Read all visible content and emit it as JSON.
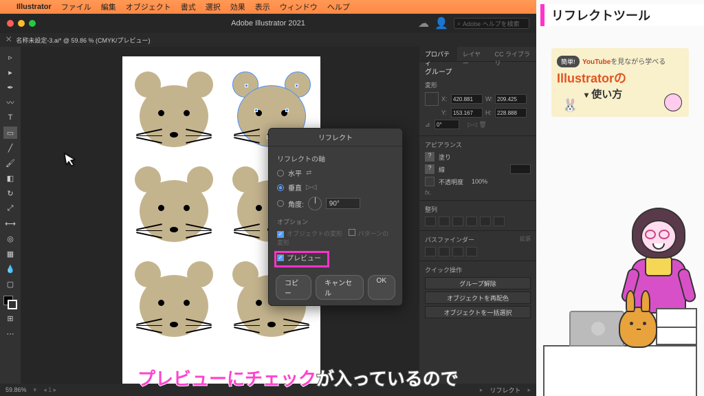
{
  "menubar": {
    "app": "Illustrator",
    "items": [
      "ファイル",
      "編集",
      "オブジェクト",
      "書式",
      "選択",
      "効果",
      "表示",
      "ウィンドウ",
      "ヘルプ"
    ]
  },
  "titlebar": {
    "title": "Adobe Illustrator 2021",
    "search_placeholder": "Adobe ヘルプを検索"
  },
  "doc_tab": "名称未設定-3.ai* @ 59.86 % (CMYK/プレビュー)",
  "panels": {
    "tabs": [
      "プロパティ",
      "レイヤー",
      "CC ライブラリ"
    ],
    "group_label": "グループ",
    "transform": {
      "title": "変形",
      "x": "420.881",
      "w": "209.425",
      "y": "153.167",
      "h": "228.888",
      "angle": "0°"
    },
    "appearance": {
      "title": "アピアランス",
      "fill": "塗り",
      "stroke": "線",
      "opacity_label": "不透明度",
      "opacity": "100%",
      "fx": "fx."
    },
    "align": {
      "title": "整列"
    },
    "pathfinder": {
      "title": "パスファインダー",
      "expand": "拡張"
    },
    "quick": {
      "title": "クイック操作",
      "btn1": "グループ解除",
      "btn2": "オブジェクトを再配色",
      "btn3": "オブジェクトを一括選択"
    }
  },
  "dialog": {
    "title": "リフレクト",
    "axis_label": "リフレクトの軸",
    "horizontal": "水平",
    "vertical": "垂直",
    "angle_label": "角度:",
    "angle_value": "90°",
    "options_label": "オプション",
    "opt_transform": "オブジェクトの変形",
    "opt_pattern": "パターンの変形",
    "preview": "プレビュー",
    "copy": "コピー",
    "cancel": "キャンセル",
    "ok": "OK"
  },
  "status": {
    "zoom": "59.86%",
    "mode": "リフレクト"
  },
  "promo": {
    "title": "リフレクトツール",
    "badge": "簡単!",
    "line1a": "YouTube",
    "line1b": "を見ながら学べる",
    "line2": "Illustratorの",
    "line3": "使い方"
  },
  "caption": {
    "pink": "プレビューにチェック",
    "white": "が入っているので"
  }
}
